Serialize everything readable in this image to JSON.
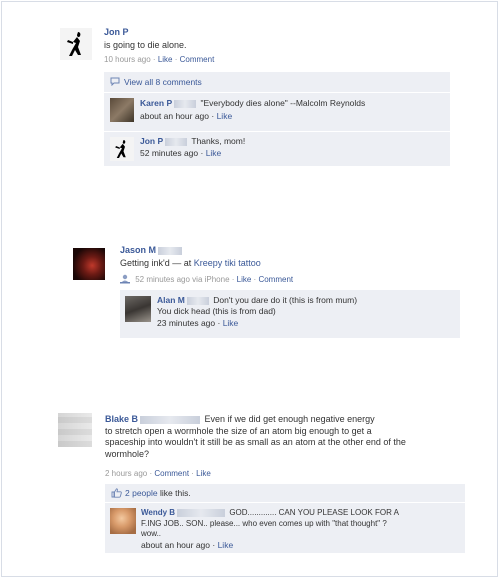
{
  "post1": {
    "author": "Jon P",
    "status": "is going to die alone.",
    "time": "10 hours ago",
    "like": "Like",
    "comment": "Comment",
    "view_all": "View all 8 comments",
    "comments": [
      {
        "author": "Karen P",
        "text": "\"Everybody dies alone\" --Malcolm Reynolds",
        "time": "about an hour ago",
        "like": "Like"
      },
      {
        "author": "Jon P",
        "text": "Thanks, mom!",
        "time": "52 minutes ago",
        "like": "Like"
      }
    ]
  },
  "post2": {
    "author": "Jason M",
    "status": "Getting ink'd — at",
    "place": "Kreepy tiki tattoo",
    "time": "52 minutes ago via iPhone",
    "like": "Like",
    "comment": "Comment",
    "comments": [
      {
        "author": "Alan M",
        "line1": "Don't you dare do it (this is from mum)",
        "line2": "You dick head (this is from dad)",
        "time": "23 minutes ago",
        "like": "Like"
      }
    ]
  },
  "post3": {
    "author": "Blake B",
    "line1": "Even if we did get enough negative energy",
    "line2": "to stretch open a wormhole the size of an atom big enough to get a",
    "line3": "spaceship into wouldn't it still be as small as an atom at the other end of the",
    "line4": "wormhole?",
    "time": "2 hours ago",
    "comment": "Comment",
    "like": "Like",
    "likes_count": "2 people",
    "likes_suffix": "like this.",
    "comments": [
      {
        "author": "Wendy B",
        "line1": "GOD............. CAN YOU PLEASE LOOK FOR A",
        "line2": "F.ING JOB.. SON.. please... who even comes up with \"that thought\" ?",
        "line3": "wow..",
        "time": "about an hour ago",
        "like": "Like"
      }
    ]
  }
}
